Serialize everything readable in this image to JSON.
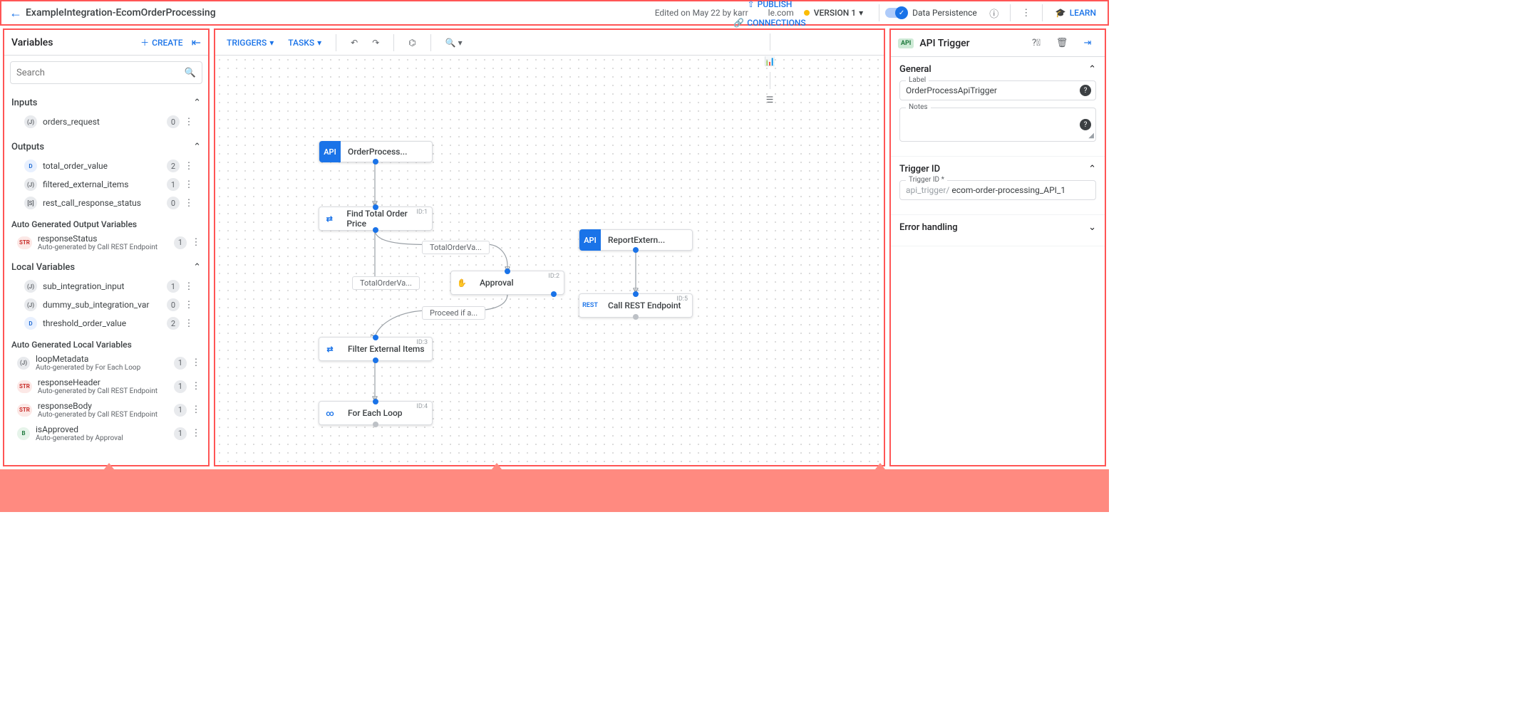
{
  "header": {
    "title": "ExampleIntegration-EcomOrderProcessing",
    "edited": "Edited on May 22 by karr",
    "domain": "le.com",
    "version": "VERSION 1",
    "persistence": "Data Persistence",
    "learn": "LEARN"
  },
  "left": {
    "title": "Variables",
    "create": "CREATE",
    "searchPlaceholder": "Search",
    "sections": {
      "inputs": "Inputs",
      "outputs": "Outputs",
      "autogenOut": "Auto Generated Output Variables",
      "local": "Local Variables",
      "autogenLocal": "Auto Generated Local Variables"
    },
    "vars": {
      "orders_request": {
        "name": "orders_request",
        "count": "0",
        "type": "(J)"
      },
      "total_order_value": {
        "name": "total_order_value",
        "count": "2",
        "type": "D"
      },
      "filtered_external_items": {
        "name": "filtered_external_items",
        "count": "1",
        "type": "(J)"
      },
      "rest_call_response_status": {
        "name": "rest_call_response_status",
        "count": "0",
        "type": "[S]"
      },
      "responseStatus": {
        "name": "responseStatus",
        "sub": "Auto-generated by Call REST Endpoint",
        "count": "1",
        "type": "STR"
      },
      "sub_integration_input": {
        "name": "sub_integration_input",
        "count": "1",
        "type": "(J)"
      },
      "dummy_sub_integration_var": {
        "name": "dummy_sub_integration_var",
        "count": "0",
        "type": "(J)"
      },
      "threshold_order_value": {
        "name": "threshold_order_value",
        "count": "2",
        "type": "D"
      },
      "loopMetadata": {
        "name": "loopMetadata",
        "sub": "Auto-generated by For Each Loop",
        "count": "1",
        "type": "(J)"
      },
      "responseHeader": {
        "name": "responseHeader",
        "sub": "Auto-generated by Call REST Endpoint",
        "count": "1",
        "type": "STR"
      },
      "responseBody": {
        "name": "responseBody",
        "sub": "Auto-generated by Call REST Endpoint",
        "count": "1",
        "type": "STR"
      },
      "isApproved": {
        "name": "isApproved",
        "sub": "Auto-generated by Approval",
        "count": "1",
        "type": "B"
      }
    }
  },
  "toolbar": {
    "triggers": "TRIGGERS",
    "tasks": "TASKS",
    "test": "TEST",
    "publish": "PUBLISH",
    "connections": "CONNECTIONS"
  },
  "nodes": {
    "t1": "OrderProcess...",
    "t2": "ReportExtern...",
    "n1": {
      "label": "Find Total Order Price",
      "id": "ID:1"
    },
    "n2": {
      "label": "Approval",
      "id": "ID:2"
    },
    "n3": {
      "label": "Filter External Items",
      "id": "ID:3"
    },
    "n4": {
      "label": "For Each Loop",
      "id": "ID:4"
    },
    "n5": {
      "label": "Call REST Endpoint",
      "id": "ID:5"
    }
  },
  "edges": {
    "e1": "TotalOrderVa...",
    "e2": "TotalOrderVa...",
    "e3": "Proceed if a..."
  },
  "right": {
    "title": "API Trigger",
    "badge": "API",
    "general": "General",
    "label": "Label",
    "labelValue": "OrderProcessApiTrigger",
    "notes": "Notes",
    "triggerIdSec": "Trigger ID",
    "triggerIdLabel": "Trigger ID *",
    "triggerPrefix": "api_trigger/",
    "triggerValue": " ecom-order-processing_API_1",
    "errorHandling": "Error handling"
  }
}
